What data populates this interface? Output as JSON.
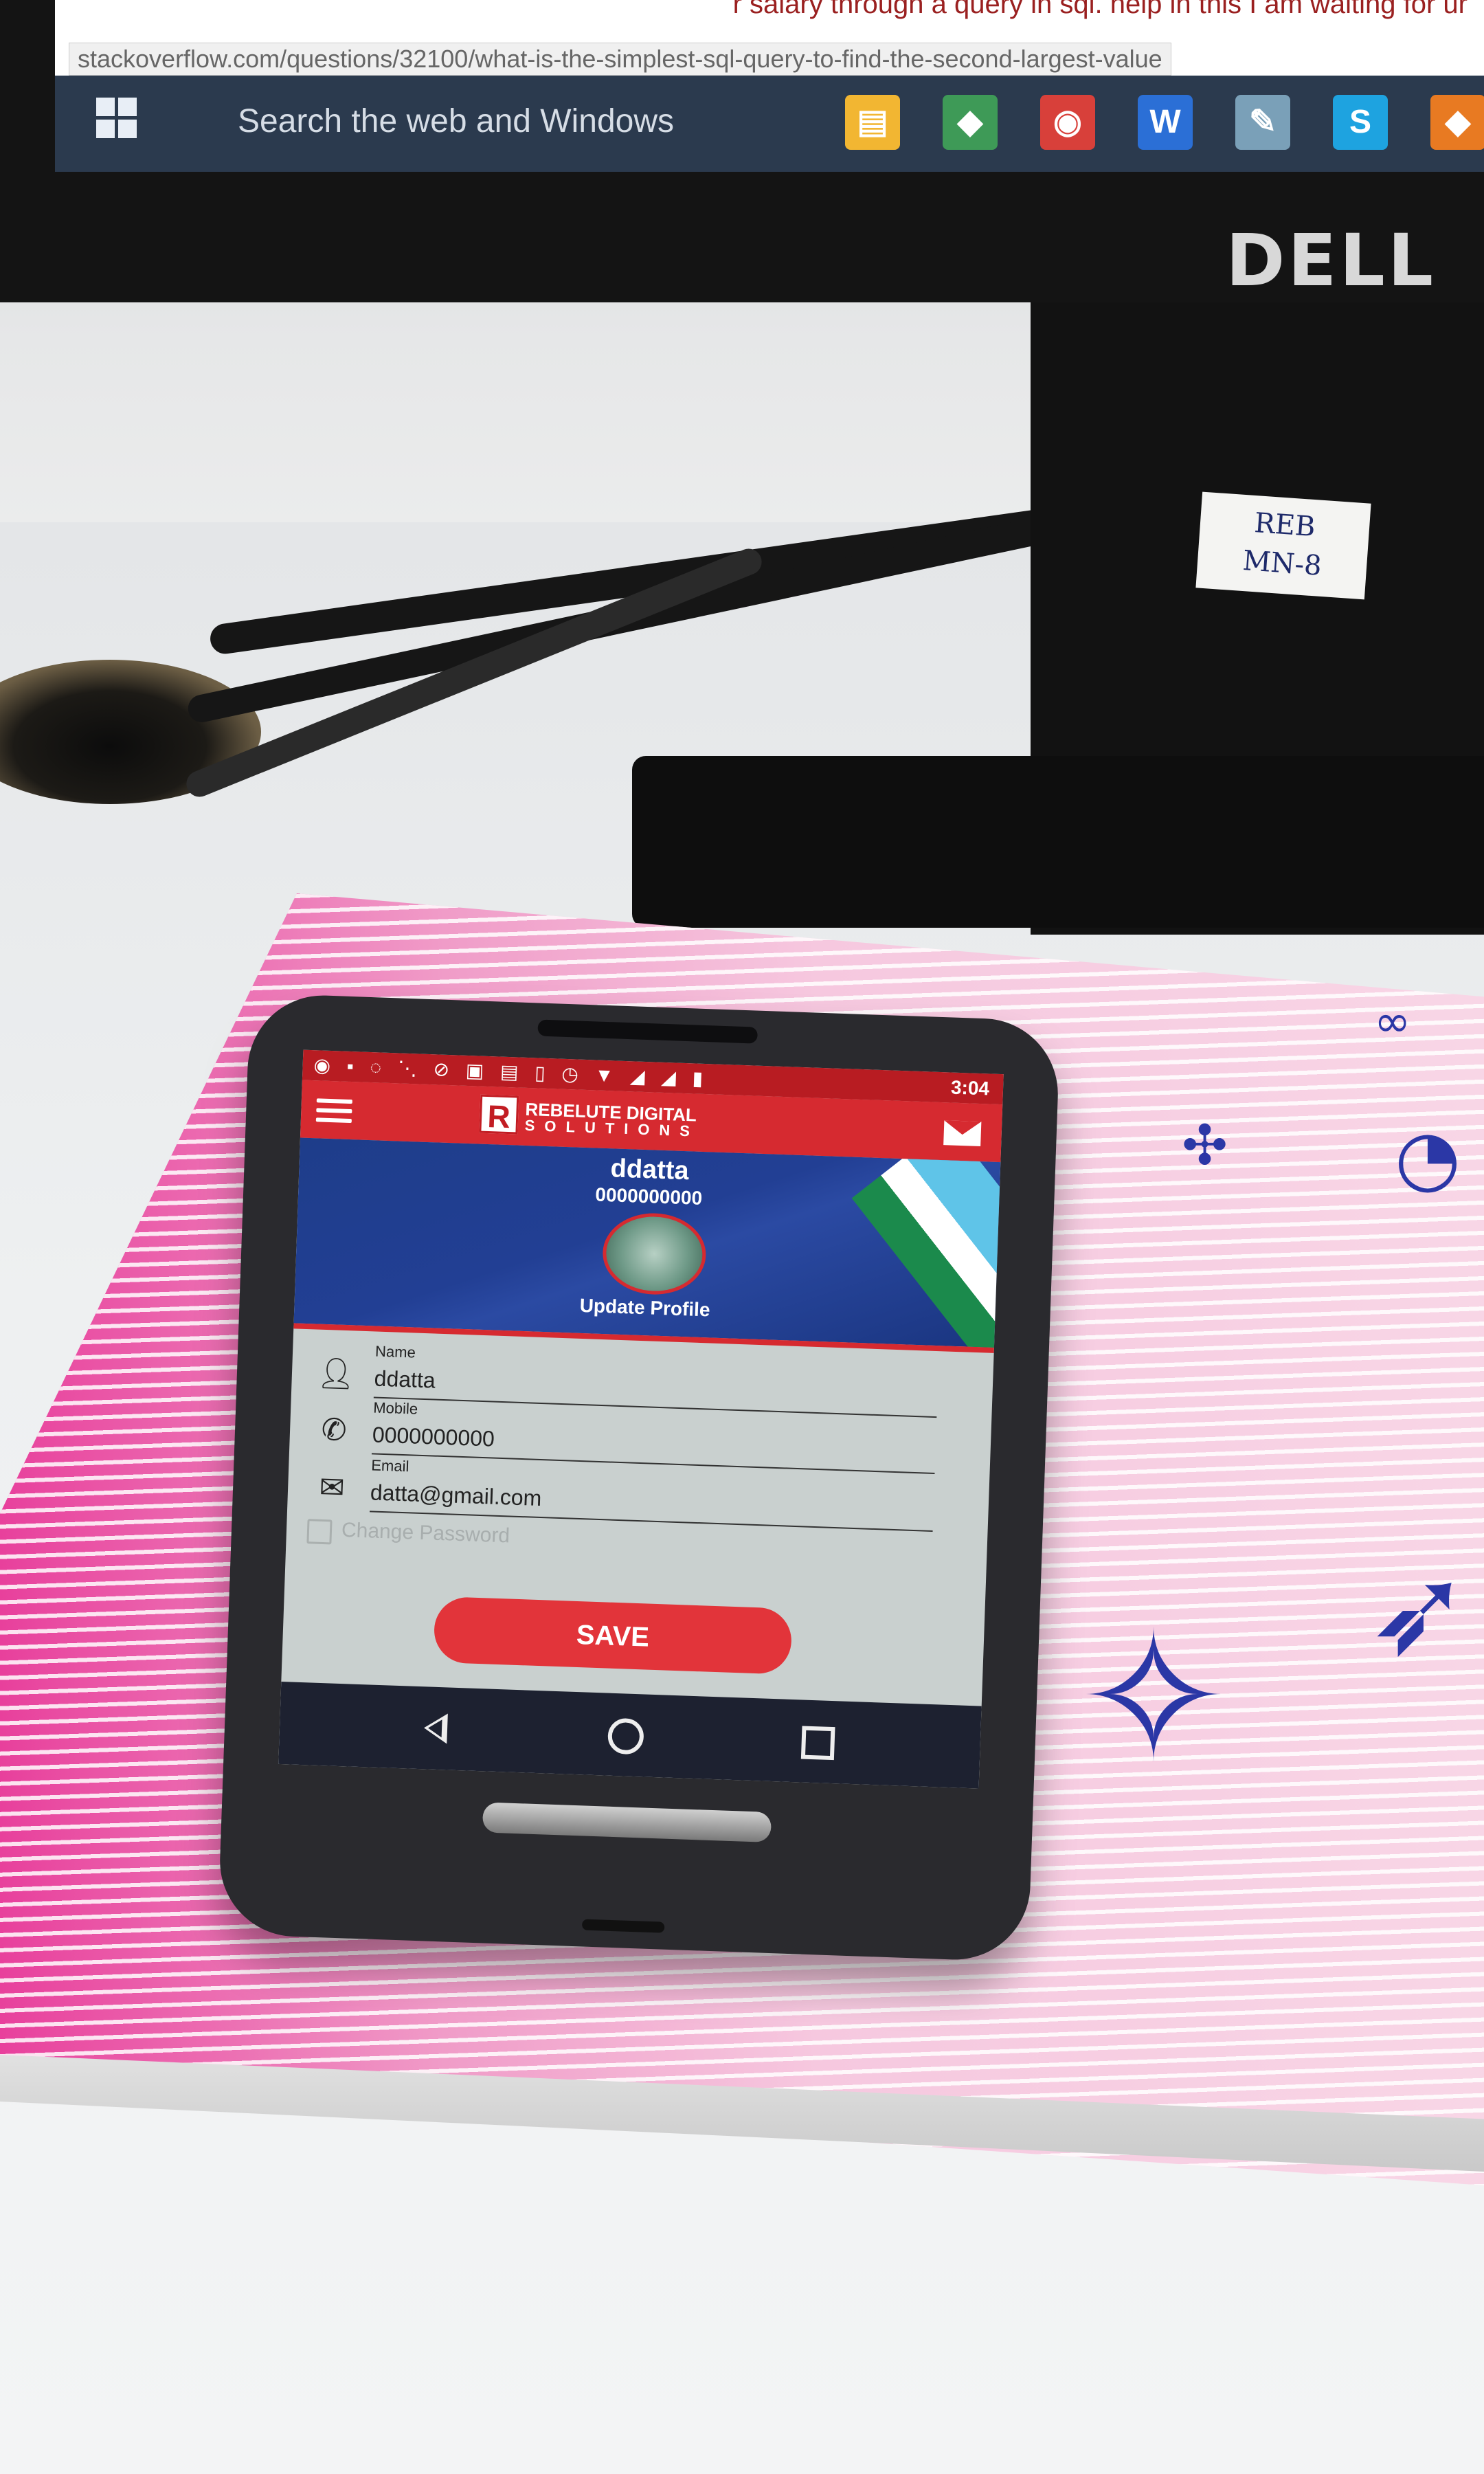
{
  "monitor": {
    "brand": "DELL",
    "page_top_text": "r salary through a query in sql. help in this I am waiting for ur",
    "status_url": "stackoverflow.com/questions/32100/what-is-the-simplest-sql-query-to-find-the-second-largest-value",
    "taskbar": {
      "search_placeholder": "Search the web and Windows",
      "icons": [
        {
          "name": "file-explorer-icon",
          "glyph": "▤",
          "color": "#f2b632"
        },
        {
          "name": "android-studio-icon",
          "glyph": "◆",
          "color": "#3e9a57"
        },
        {
          "name": "chrome-icon",
          "glyph": "◉",
          "color": "#d8403a"
        },
        {
          "name": "word-icon",
          "glyph": "W",
          "color": "#2b6fd6"
        },
        {
          "name": "notes-icon",
          "glyph": "✎",
          "color": "#7aa0b8"
        },
        {
          "name": "skype-icon",
          "glyph": "S",
          "color": "#1ea3e0"
        },
        {
          "name": "android-studio-alt-icon",
          "glyph": "◆",
          "color": "#e87a22"
        }
      ]
    },
    "sticker_lines": [
      "REB",
      "MN-8"
    ]
  },
  "phone": {
    "status_bar": {
      "left_icons": "◉ ▪ ◌ ⋱ ⊘ ▣ ▤ ▯ ◷ ▼ ◢ ◢ ▮",
      "time": "3:04"
    },
    "toolbar": {
      "brand_logo": "R",
      "brand_line1": "REBELUTE DIGITAL",
      "brand_line2": "SOLUTIONS",
      "menu_icon": "menu-icon",
      "mail_icon": "mail-icon"
    },
    "profile": {
      "name": "ddatta",
      "phone": "0000000000",
      "update_label": "Update Profile"
    },
    "form": {
      "name_label": "Name",
      "name_value": "ddatta",
      "mobile_label": "Mobile",
      "mobile_value": "0000000000",
      "email_label": "Email",
      "email_value": "datta@gmail.com",
      "change_password_label": "Change Password",
      "change_password_checked": false,
      "save_label": "SAVE"
    },
    "colors": {
      "primary": "#d62a30",
      "hero": "#223f94",
      "background": "#c9d0cf",
      "navbar": "#1d2130"
    }
  }
}
